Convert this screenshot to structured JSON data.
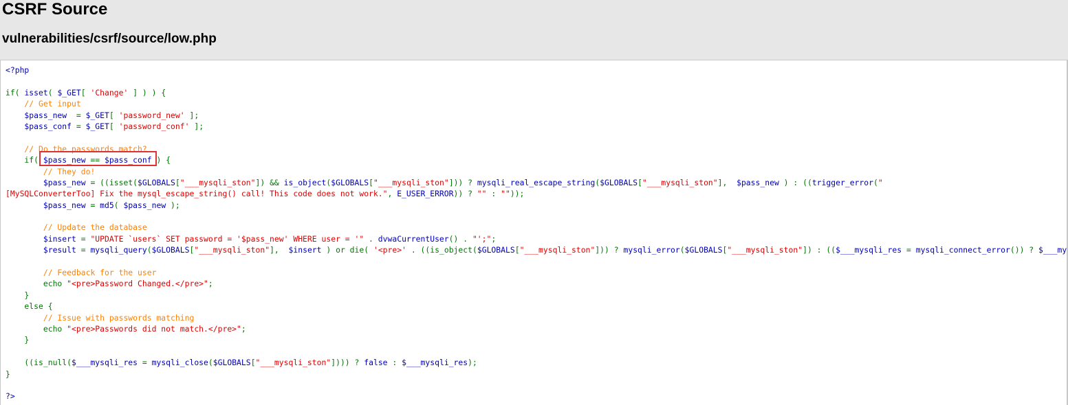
{
  "header": {
    "title": "CSRF Source",
    "subtitle": "vulnerabilities/csrf/source/low.php"
  },
  "colors": {
    "background": "#e7e7e7",
    "code_background": "#ffffff",
    "php_default": "#0000bb",
    "php_keyword": "#007700",
    "php_string": "#dd0000",
    "php_comment": "#ff8000",
    "highlight_border": "#e03030"
  },
  "code": {
    "lines": [
      [
        {
          "t": "default",
          "v": "<?php"
        }
      ],
      [],
      [
        {
          "t": "keyword",
          "v": "if( "
        },
        {
          "t": "default",
          "v": "isset"
        },
        {
          "t": "keyword",
          "v": "( "
        },
        {
          "t": "default",
          "v": "$_GET"
        },
        {
          "t": "keyword",
          "v": "[ "
        },
        {
          "t": "string",
          "v": "'Change'"
        },
        {
          "t": "keyword",
          "v": " ] ) ) {"
        }
      ],
      [
        {
          "t": "comment",
          "v": "    // Get input"
        }
      ],
      [
        {
          "t": "default",
          "v": "    $pass_new  "
        },
        {
          "t": "keyword",
          "v": "= "
        },
        {
          "t": "default",
          "v": "$_GET"
        },
        {
          "t": "keyword",
          "v": "[ "
        },
        {
          "t": "string",
          "v": "'password_new'"
        },
        {
          "t": "keyword",
          "v": " ];"
        }
      ],
      [
        {
          "t": "default",
          "v": "    $pass_conf "
        },
        {
          "t": "keyword",
          "v": "= "
        },
        {
          "t": "default",
          "v": "$_GET"
        },
        {
          "t": "keyword",
          "v": "[ "
        },
        {
          "t": "string",
          "v": "'password_conf'"
        },
        {
          "t": "keyword",
          "v": " ];"
        }
      ],
      [],
      [
        {
          "t": "comment",
          "v": "    // Do the passwords match?"
        }
      ],
      [
        {
          "t": "keyword",
          "v": "    if( "
        },
        {
          "t": "default",
          "v": "$pass_new "
        },
        {
          "t": "keyword",
          "v": "== "
        },
        {
          "t": "default",
          "v": "$pass_conf "
        },
        {
          "t": "keyword",
          "v": ") {"
        }
      ],
      [
        {
          "t": "comment",
          "v": "        // They do!"
        }
      ],
      [
        {
          "t": "default",
          "v": "        $pass_new "
        },
        {
          "t": "keyword",
          "v": "= ((isset("
        },
        {
          "t": "default",
          "v": "$GLOBALS"
        },
        {
          "t": "keyword",
          "v": "["
        },
        {
          "t": "string",
          "v": "\"___mysqli_ston\""
        },
        {
          "t": "keyword",
          "v": "]) && "
        },
        {
          "t": "default",
          "v": "is_object"
        },
        {
          "t": "keyword",
          "v": "("
        },
        {
          "t": "default",
          "v": "$GLOBALS"
        },
        {
          "t": "keyword",
          "v": "["
        },
        {
          "t": "string",
          "v": "\"___mysqli_ston\""
        },
        {
          "t": "keyword",
          "v": "])) ? "
        },
        {
          "t": "default",
          "v": "mysqli_real_escape_string"
        },
        {
          "t": "keyword",
          "v": "("
        },
        {
          "t": "default",
          "v": "$GLOBALS"
        },
        {
          "t": "keyword",
          "v": "["
        },
        {
          "t": "string",
          "v": "\"___mysqli_ston\""
        },
        {
          "t": "keyword",
          "v": "],  "
        },
        {
          "t": "default",
          "v": "$pass_new "
        },
        {
          "t": "keyword",
          "v": ") : (("
        },
        {
          "t": "default",
          "v": "trigger_error"
        },
        {
          "t": "keyword",
          "v": "("
        },
        {
          "t": "string",
          "v": "\""
        }
      ],
      [
        {
          "t": "string",
          "v": "[MySQLConverterToo] Fix the mysql_escape_string() call! This code does not work.\""
        },
        {
          "t": "keyword",
          "v": ", "
        },
        {
          "t": "default",
          "v": "E_USER_ERROR"
        },
        {
          "t": "keyword",
          "v": ")) ? "
        },
        {
          "t": "string",
          "v": "\"\""
        },
        {
          "t": "keyword",
          "v": " : "
        },
        {
          "t": "string",
          "v": "\"\""
        },
        {
          "t": "keyword",
          "v": "));"
        }
      ],
      [
        {
          "t": "default",
          "v": "        $pass_new "
        },
        {
          "t": "keyword",
          "v": "= "
        },
        {
          "t": "default",
          "v": "md5"
        },
        {
          "t": "keyword",
          "v": "( "
        },
        {
          "t": "default",
          "v": "$pass_new "
        },
        {
          "t": "keyword",
          "v": ");"
        }
      ],
      [],
      [
        {
          "t": "comment",
          "v": "        // Update the database"
        }
      ],
      [
        {
          "t": "default",
          "v": "        $insert "
        },
        {
          "t": "keyword",
          "v": "= "
        },
        {
          "t": "string",
          "v": "\"UPDATE `users` SET password = '$pass_new' WHERE user = '\""
        },
        {
          "t": "keyword",
          "v": " . "
        },
        {
          "t": "default",
          "v": "dvwaCurrentUser"
        },
        {
          "t": "keyword",
          "v": "() . "
        },
        {
          "t": "string",
          "v": "\"';\""
        },
        {
          "t": "keyword",
          "v": ";"
        }
      ],
      [
        {
          "t": "default",
          "v": "        $result "
        },
        {
          "t": "keyword",
          "v": "= "
        },
        {
          "t": "default",
          "v": "mysqli_query"
        },
        {
          "t": "keyword",
          "v": "("
        },
        {
          "t": "default",
          "v": "$GLOBALS"
        },
        {
          "t": "keyword",
          "v": "["
        },
        {
          "t": "string",
          "v": "\"___mysqli_ston\""
        },
        {
          "t": "keyword",
          "v": "],  "
        },
        {
          "t": "default",
          "v": "$insert "
        },
        {
          "t": "keyword",
          "v": ") or die( "
        },
        {
          "t": "string",
          "v": "'<pre>'"
        },
        {
          "t": "keyword",
          "v": " . ((is_object("
        },
        {
          "t": "default",
          "v": "$GLOBALS"
        },
        {
          "t": "keyword",
          "v": "["
        },
        {
          "t": "string",
          "v": "\"___mysqli_ston\""
        },
        {
          "t": "keyword",
          "v": "])) ? "
        },
        {
          "t": "default",
          "v": "mysqli_error"
        },
        {
          "t": "keyword",
          "v": "("
        },
        {
          "t": "default",
          "v": "$GLOBALS"
        },
        {
          "t": "keyword",
          "v": "["
        },
        {
          "t": "string",
          "v": "\"___mysqli_ston\""
        },
        {
          "t": "keyword",
          "v": "]) : (("
        },
        {
          "t": "default",
          "v": "$___mysqli_res "
        },
        {
          "t": "keyword",
          "v": "= "
        },
        {
          "t": "default",
          "v": "mysqli_connect_error"
        },
        {
          "t": "keyword",
          "v": "()) ? "
        },
        {
          "t": "default",
          "v": "$___mysqli_res"
        }
      ],
      [],
      [
        {
          "t": "comment",
          "v": "        // Feedback for the user"
        }
      ],
      [
        {
          "t": "keyword",
          "v": "        echo "
        },
        {
          "t": "string",
          "v": "\"<pre>Password Changed.</pre>\""
        },
        {
          "t": "keyword",
          "v": ";"
        }
      ],
      [
        {
          "t": "keyword",
          "v": "    }"
        }
      ],
      [
        {
          "t": "keyword",
          "v": "    else {"
        }
      ],
      [
        {
          "t": "comment",
          "v": "        // Issue with passwords matching"
        }
      ],
      [
        {
          "t": "keyword",
          "v": "        echo "
        },
        {
          "t": "string",
          "v": "\"<pre>Passwords did not match.</pre>\""
        },
        {
          "t": "keyword",
          "v": ";"
        }
      ],
      [
        {
          "t": "keyword",
          "v": "    }"
        }
      ],
      [],
      [
        {
          "t": "keyword",
          "v": "    ((is_null("
        },
        {
          "t": "default",
          "v": "$___mysqli_res "
        },
        {
          "t": "keyword",
          "v": "= "
        },
        {
          "t": "default",
          "v": "mysqli_close"
        },
        {
          "t": "keyword",
          "v": "("
        },
        {
          "t": "default",
          "v": "$GLOBALS"
        },
        {
          "t": "keyword",
          "v": "["
        },
        {
          "t": "string",
          "v": "\"___mysqli_ston\""
        },
        {
          "t": "keyword",
          "v": "]))) ? "
        },
        {
          "t": "default",
          "v": "false "
        },
        {
          "t": "keyword",
          "v": ": "
        },
        {
          "t": "default",
          "v": "$___mysqli_res"
        },
        {
          "t": "keyword",
          "v": ");"
        }
      ],
      [
        {
          "t": "keyword",
          "v": "}"
        }
      ],
      [],
      [
        {
          "t": "default",
          "v": "?>"
        }
      ]
    ]
  }
}
